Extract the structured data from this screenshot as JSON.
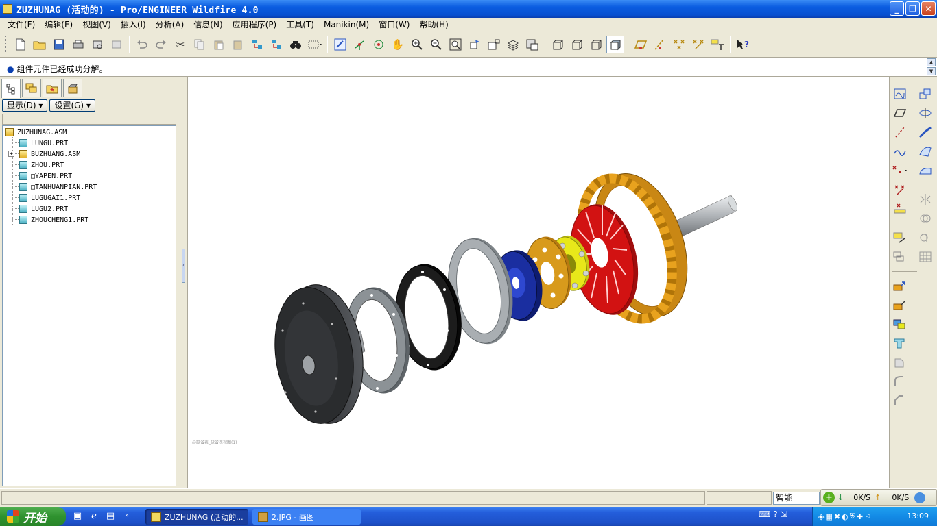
{
  "window": {
    "title": "ZUZHUNAG (活动的) - Pro/ENGINEER Wildfire 4.0",
    "controls": {
      "minimize": "_",
      "maximize": "❐",
      "close": "✕"
    }
  },
  "menu": [
    {
      "label": "文件(F)"
    },
    {
      "label": "编辑(E)"
    },
    {
      "label": "视图(V)"
    },
    {
      "label": "插入(I)"
    },
    {
      "label": "分析(A)"
    },
    {
      "label": "信息(N)"
    },
    {
      "label": "应用程序(P)"
    },
    {
      "label": "工具(T)"
    },
    {
      "label": "Manikin(M)"
    },
    {
      "label": "窗口(W)"
    },
    {
      "label": "帮助(H)"
    }
  ],
  "toolbar": {
    "icons": {
      "new": "new-file-icon",
      "open": "open-folder-icon",
      "save": "save-icon",
      "print": "print-icon",
      "undo": "undo-icon",
      "redo": "redo-icon",
      "zoom_in": "zoom-in-icon",
      "zoom_out": "zoom-out-icon",
      "help": "context-help-icon"
    }
  },
  "message": {
    "text": "组件元件已经成功分解。"
  },
  "left_panel": {
    "buttons": {
      "show": "显示(D)",
      "settings": "设置(G)"
    },
    "tree": [
      {
        "label": "ZUZHUNAG.ASM",
        "type": "asm"
      },
      {
        "label": "LUNGU.PRT",
        "type": "prt"
      },
      {
        "label": "BUZHUANG.ASM",
        "type": "asm"
      },
      {
        "label": "ZHOU.PRT",
        "type": "prt"
      },
      {
        "label": "□YAPEN.PRT",
        "type": "prt"
      },
      {
        "label": "□TANHUANPIAN.PRT",
        "type": "prt"
      },
      {
        "label": "LUGUGAI1.PRT",
        "type": "prt"
      },
      {
        "label": "LUGU2.PRT",
        "type": "prt"
      },
      {
        "label": "ZHOUCHENG1.PRT",
        "type": "prt"
      }
    ],
    "expand_symbol": "+"
  },
  "graphics": {
    "view_caption": "@缺省表_缺省表视图(1)",
    "part_colors": {
      "flywheel": "#4a4c50",
      "gray_ring": "#8c9296",
      "black_ring": "#1c1c1c",
      "thin_ring": "#a9aeb2",
      "blue_disc": "#1a2ea0",
      "orange_plate": "#d89a1c",
      "yellow_hub": "#e8e81a",
      "red_spring": "#d21212",
      "housing": "#e8a21e",
      "shaft": "#b8bcc0"
    }
  },
  "status": {
    "filter": "智能"
  },
  "net_widget": {
    "download": "0K/S",
    "upload": "0K/S",
    "down_arrow": "↓",
    "up_arrow": "↑"
  },
  "taskbar": {
    "start": "开始",
    "tasks": [
      {
        "label": "ZUZHUNAG (活动的..."
      },
      {
        "label": "2.JPG - 画图"
      }
    ],
    "clock": "13:09"
  }
}
